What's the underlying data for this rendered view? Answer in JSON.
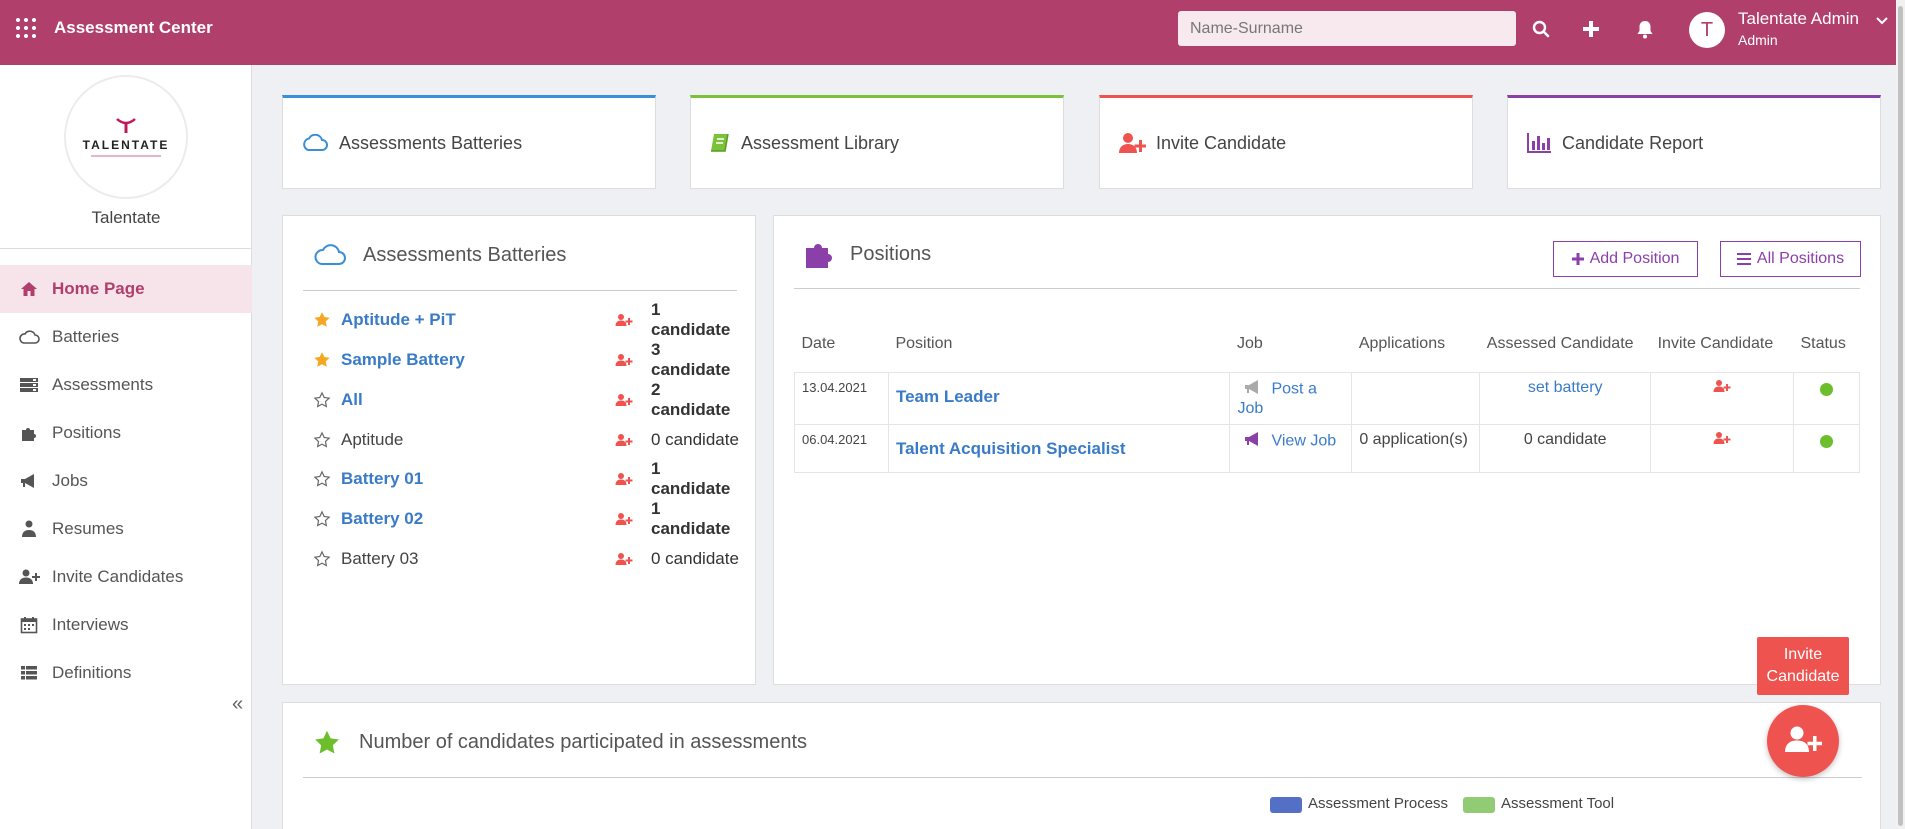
{
  "header": {
    "app_title": "Assessment Center",
    "search_placeholder": "Name-Surname",
    "user": {
      "initial": "T",
      "name": "Talentate Admin",
      "role": "Admin"
    }
  },
  "sidebar": {
    "company": "Talentate",
    "logo_text": "TALENTATE",
    "items": [
      {
        "label": "Home Page",
        "icon": "home-icon"
      },
      {
        "label": "Batteries",
        "icon": "cloud-icon"
      },
      {
        "label": "Assessments",
        "icon": "server-icon"
      },
      {
        "label": "Positions",
        "icon": "puzzle-icon"
      },
      {
        "label": "Jobs",
        "icon": "megaphone-icon"
      },
      {
        "label": "Resumes",
        "icon": "user-tie-icon"
      },
      {
        "label": "Invite Candidates",
        "icon": "user-plus-icon"
      },
      {
        "label": "Interviews",
        "icon": "calendar-icon"
      },
      {
        "label": "Definitions",
        "icon": "list-icon"
      }
    ]
  },
  "tiles": [
    {
      "label": "Assessments Batteries",
      "accent": "#3a8fd6",
      "icon": "cloud-icon"
    },
    {
      "label": "Assessment Library",
      "accent": "#7cc13a",
      "icon": "book-icon"
    },
    {
      "label": "Invite Candidate",
      "accent": "#ef5350",
      "icon": "user-plus-icon"
    },
    {
      "label": "Candidate Report",
      "accent": "#8b3fa8",
      "icon": "bar-chart-icon"
    }
  ],
  "batteries": {
    "title": "Assessments Batteries",
    "rows": [
      {
        "name": "Aptitude + PiT",
        "count": "1 candidate",
        "starred": true,
        "link": true
      },
      {
        "name": "Sample Battery",
        "count": "3 candidate",
        "starred": true,
        "link": true
      },
      {
        "name": "All",
        "count": "2 candidate",
        "starred": false,
        "link": true
      },
      {
        "name": "Aptitude",
        "count": "0 candidate",
        "starred": false,
        "link": false
      },
      {
        "name": "Battery 01",
        "count": "1 candidate",
        "starred": false,
        "link": true
      },
      {
        "name": "Battery 02",
        "count": "1 candidate",
        "starred": false,
        "link": true
      },
      {
        "name": "Battery 03",
        "count": "0 candidate",
        "starred": false,
        "link": false
      }
    ]
  },
  "positions": {
    "title": "Positions",
    "add_label": "Add Position",
    "all_label": "All Positions",
    "columns": [
      "Date",
      "Position",
      "Job",
      "Applications",
      "Assessed Candidate",
      "Invite Candidate",
      "Status"
    ],
    "rows": [
      {
        "date": "13.04.2021",
        "position": "Team Leader",
        "job": "Post a Job",
        "applications": "",
        "assessed": "set battery"
      },
      {
        "date": "06.04.2021",
        "position": "Talent Acquisition Specialist",
        "job": "View Job",
        "applications": "0 application(s)",
        "assessed": "0 candidate"
      }
    ]
  },
  "participation": {
    "title": "Number of candidates participated in assessments",
    "legend": [
      {
        "label": "Assessment Process",
        "color": "#5470c6"
      },
      {
        "label": "Assessment Tool",
        "color": "#91cc75"
      }
    ]
  },
  "fab": {
    "label": "Invite Candidate"
  }
}
